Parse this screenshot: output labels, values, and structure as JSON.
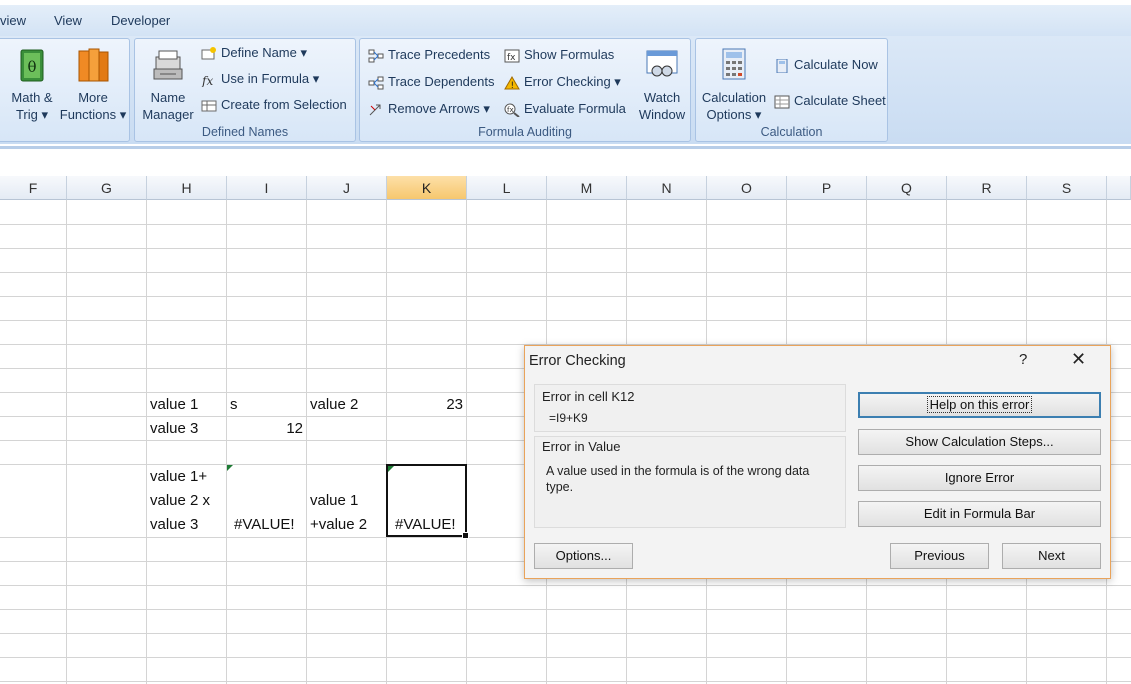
{
  "tabs": [
    "view",
    "View",
    "Developer"
  ],
  "ribbon": {
    "math_trig": {
      "line1": "Math &",
      "line2": "Trig ▾"
    },
    "more_functions": {
      "line1": "More",
      "line2": "Functions ▾"
    },
    "defined_names": {
      "name_manager": {
        "line1": "Name",
        "line2": "Manager"
      },
      "define_name": "Define Name ▾",
      "use_in_formula": "Use in Formula ▾",
      "create_from_selection": "Create from Selection",
      "caption": "Defined Names"
    },
    "formula_auditing": {
      "trace_precedents": "Trace Precedents",
      "trace_dependents": "Trace Dependents",
      "remove_arrows": "Remove Arrows ▾",
      "show_formulas": "Show Formulas",
      "error_checking": "Error Checking ▾",
      "evaluate_formula": "Evaluate Formula",
      "watch_window": {
        "line1": "Watch",
        "line2": "Window"
      },
      "caption": "Formula Auditing"
    },
    "calculation": {
      "options": {
        "line1": "Calculation",
        "line2": "Options ▾"
      },
      "calculate_now": "Calculate Now",
      "calculate_sheet": "Calculate Sheet",
      "caption": "Calculation"
    }
  },
  "grid": {
    "columns": [
      "F",
      "G",
      "H",
      "I",
      "J",
      "K",
      "L",
      "M",
      "N",
      "O",
      "P",
      "Q",
      "R",
      "S"
    ],
    "selected_column": "K",
    "cells": {
      "h9": "value 1",
      "i9": "s",
      "j9": "value 2",
      "k9": "23",
      "h10": "value 3",
      "i10": "12",
      "h12a": "value 1+",
      "h12b": "value 2 x",
      "h12c": "value 3",
      "i12": "#VALUE!",
      "j12b": "value 1",
      "j12c": "+value 2",
      "k12": "#VALUE!"
    }
  },
  "dialog": {
    "title": "Error Checking",
    "help_glyph": "?",
    "close_glyph": "✕",
    "error_cell_label": "Error in cell K12",
    "formula": "=I9+K9",
    "error_type_label": "Error in Value",
    "error_description": "A value used in the formula is of the wrong data type.",
    "buttons": {
      "help": "Help on this error",
      "show_steps": "Show Calculation Steps...",
      "ignore": "Ignore Error",
      "edit_formula_bar": "Edit in Formula Bar",
      "options": "Options...",
      "previous": "Previous",
      "next": "Next"
    }
  },
  "colors": {
    "accent": "#e9a35a",
    "ribbon": "#d3e3f5",
    "selected_header": "#f6c76e"
  }
}
